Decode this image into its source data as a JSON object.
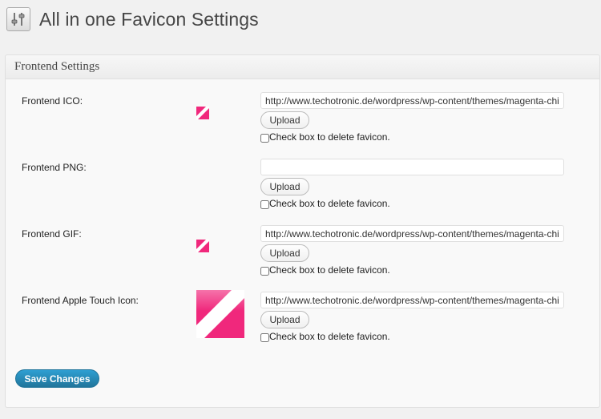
{
  "page": {
    "title": "All in one Favicon Settings",
    "icon": "settings-sliders-icon"
  },
  "section": {
    "title": "Frontend Settings"
  },
  "fields": [
    {
      "label": "Frontend ICO:",
      "value": "http://www.techotronic.de/wordpress/wp-content/themes/magenta-child",
      "placeholder": "",
      "upload_label": "Upload",
      "delete_label": "Check box to delete favicon.",
      "preview": "small"
    },
    {
      "label": "Frontend PNG:",
      "value": "",
      "placeholder": "",
      "upload_label": "Upload",
      "delete_label": "Check box to delete favicon.",
      "preview": "none"
    },
    {
      "label": "Frontend GIF:",
      "value": "http://www.techotronic.de/wordpress/wp-content/themes/magenta-child",
      "placeholder": "",
      "upload_label": "Upload",
      "delete_label": "Check box to delete favicon.",
      "preview": "small"
    },
    {
      "label": "Frontend Apple Touch Icon:",
      "value": "http://www.techotronic.de/wordpress/wp-content/themes/magenta-child",
      "placeholder": "",
      "upload_label": "Upload",
      "delete_label": "Check box to delete favicon.",
      "preview": "large"
    }
  ],
  "actions": {
    "save_label": "Save Changes"
  },
  "colors": {
    "favicon_pink": "#f0287c",
    "primary_button": "#21759b"
  }
}
